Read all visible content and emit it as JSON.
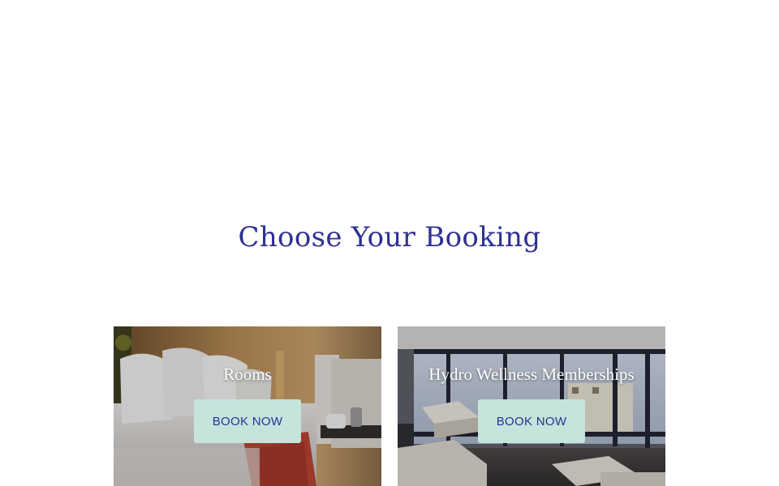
{
  "section": {
    "heading": "Choose Your Booking"
  },
  "cards": [
    {
      "title": "Rooms",
      "button_label": "BOOK NOW",
      "image": "hotel-bedroom-photo"
    },
    {
      "title": "Hydro Wellness Memberships",
      "button_label": "BOOK NOW",
      "image": "wellness-relaxation-room-photo"
    }
  ],
  "colors": {
    "heading": "#2e3192",
    "button_background": "#c4e4dc",
    "button_text": "#2e3192",
    "card_title": "#ffffff"
  }
}
